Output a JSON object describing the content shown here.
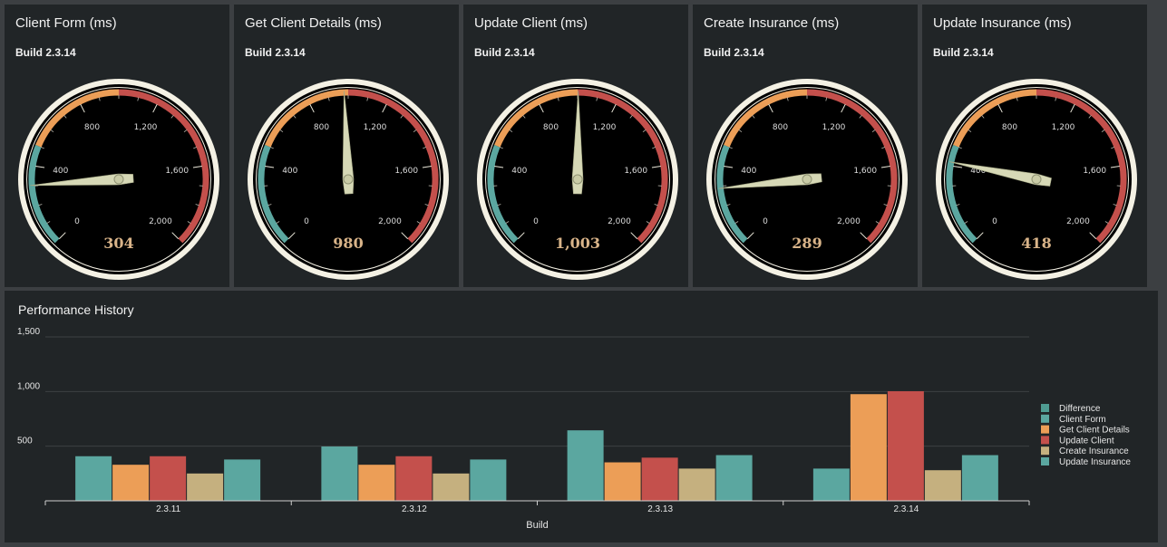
{
  "gauges": [
    {
      "title": "Client Form (ms)",
      "subtitle": "Build 2.3.14",
      "value": 304,
      "value_label": "304"
    },
    {
      "title": "Get Client Details (ms)",
      "subtitle": "Build 2.3.14",
      "value": 980,
      "value_label": "980"
    },
    {
      "title": "Update Client (ms)",
      "subtitle": "Build 2.3.14",
      "value": 1003,
      "value_label": "1,003"
    },
    {
      "title": "Create Insurance (ms)",
      "subtitle": "Build 2.3.14",
      "value": 289,
      "value_label": "289"
    },
    {
      "title": "Update Insurance (ms)",
      "subtitle": "Build 2.3.14",
      "value": 418,
      "value_label": "418"
    }
  ],
  "gauge_scale": {
    "min": 0,
    "max": 2000,
    "ticks": [
      0,
      400,
      800,
      1200,
      1600,
      2000
    ],
    "tick_labels": [
      "0",
      "400",
      "800",
      "1,200",
      "1,600",
      "2,000"
    ],
    "bands": [
      {
        "from": 0,
        "to": 500,
        "color": "#5ba7a0"
      },
      {
        "from": 500,
        "to": 1000,
        "color": "#ec9e57"
      },
      {
        "from": 1000,
        "to": 2000,
        "color": "#c4504c"
      }
    ]
  },
  "history": {
    "title": "Performance History"
  },
  "chart_data": {
    "type": "bar",
    "title": "Performance History",
    "xlabel": "Build",
    "ylabel": "",
    "ylim": [
      0,
      1500
    ],
    "yticks": [
      500,
      1000,
      1500
    ],
    "ytick_labels": [
      "500",
      "1,000",
      "1,500"
    ],
    "categories": [
      "2.3.11",
      "2.3.12",
      "2.3.13",
      "2.3.14"
    ],
    "series": [
      {
        "name": "Difference",
        "color": "#4f9c92",
        "values": [
          null,
          null,
          null,
          null
        ]
      },
      {
        "name": "Client Form",
        "color": "#5ba7a0",
        "values": [
          408,
          497,
          645,
          295
        ]
      },
      {
        "name": "Get Client Details",
        "color": "#ec9e57",
        "values": [
          330,
          330,
          352,
          976
        ]
      },
      {
        "name": "Update Client",
        "color": "#c4504c",
        "values": [
          408,
          408,
          395,
          1003
        ]
      },
      {
        "name": "Create Insurance",
        "color": "#c5b07f",
        "values": [
          250,
          250,
          295,
          280
        ]
      },
      {
        "name": "Update Insurance",
        "color": "#5ba7a0",
        "values": [
          378,
          378,
          418,
          418
        ]
      }
    ],
    "legend_position": "right",
    "grid": true
  }
}
